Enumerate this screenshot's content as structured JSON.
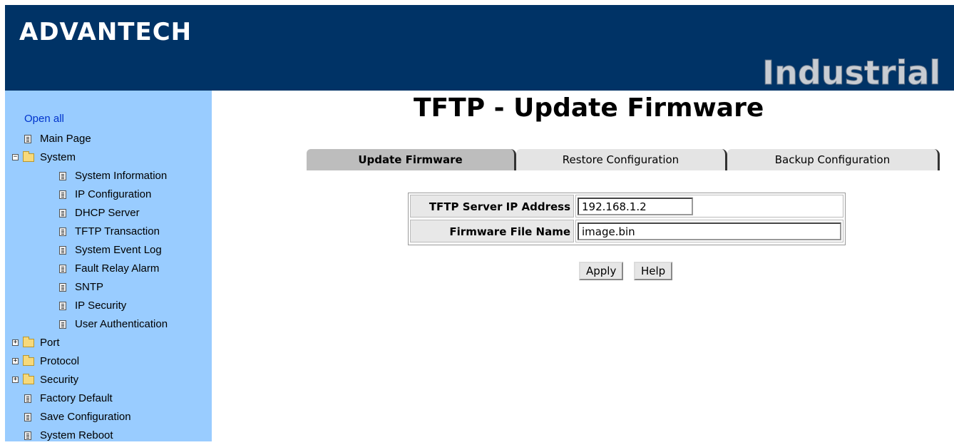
{
  "header": {
    "logo": "ADVANTECH",
    "banner_title": "Industrial S"
  },
  "sidebar": {
    "open_all": "Open all",
    "items": [
      {
        "label": "Main Page",
        "type": "doc",
        "indent": 0
      },
      {
        "label": "System",
        "type": "folder-open",
        "indent": 0,
        "expander": "−"
      },
      {
        "label": "System Information",
        "type": "doc",
        "indent": 1
      },
      {
        "label": "IP Configuration",
        "type": "doc",
        "indent": 1
      },
      {
        "label": "DHCP Server",
        "type": "doc",
        "indent": 1
      },
      {
        "label": "TFTP Transaction",
        "type": "doc",
        "indent": 1
      },
      {
        "label": "System Event Log",
        "type": "doc",
        "indent": 1
      },
      {
        "label": "Fault Relay Alarm",
        "type": "doc",
        "indent": 1
      },
      {
        "label": "SNTP",
        "type": "doc",
        "indent": 1
      },
      {
        "label": "IP Security",
        "type": "doc",
        "indent": 1
      },
      {
        "label": "User Authentication",
        "type": "doc",
        "indent": 1
      },
      {
        "label": "Port",
        "type": "folder",
        "indent": 0,
        "expander": "+"
      },
      {
        "label": "Protocol",
        "type": "folder",
        "indent": 0,
        "expander": "+"
      },
      {
        "label": "Security",
        "type": "folder",
        "indent": 0,
        "expander": "+"
      },
      {
        "label": "Factory Default",
        "type": "doc",
        "indent": 0
      },
      {
        "label": "Save Configuration",
        "type": "doc",
        "indent": 0
      },
      {
        "label": "System Reboot",
        "type": "doc",
        "indent": 0
      }
    ]
  },
  "main": {
    "title": "TFTP - Update Firmware",
    "tabs": [
      {
        "label": "Update Firmware",
        "active": true
      },
      {
        "label": "Restore Configuration",
        "active": false
      },
      {
        "label": "Backup Configuration",
        "active": false
      }
    ],
    "form": {
      "server_ip_label": "TFTP Server IP Address",
      "server_ip_value": "192.168.1.2",
      "file_name_label": "Firmware File Name",
      "file_name_value": "image.bin"
    },
    "buttons": {
      "apply": "Apply",
      "help": "Help"
    }
  },
  "colors": {
    "banner": "#003366",
    "sidebar": "#99ccff",
    "link": "#0033cc",
    "active_tab": "#bdbdbd",
    "inactive_tab": "#e4e4e4"
  }
}
